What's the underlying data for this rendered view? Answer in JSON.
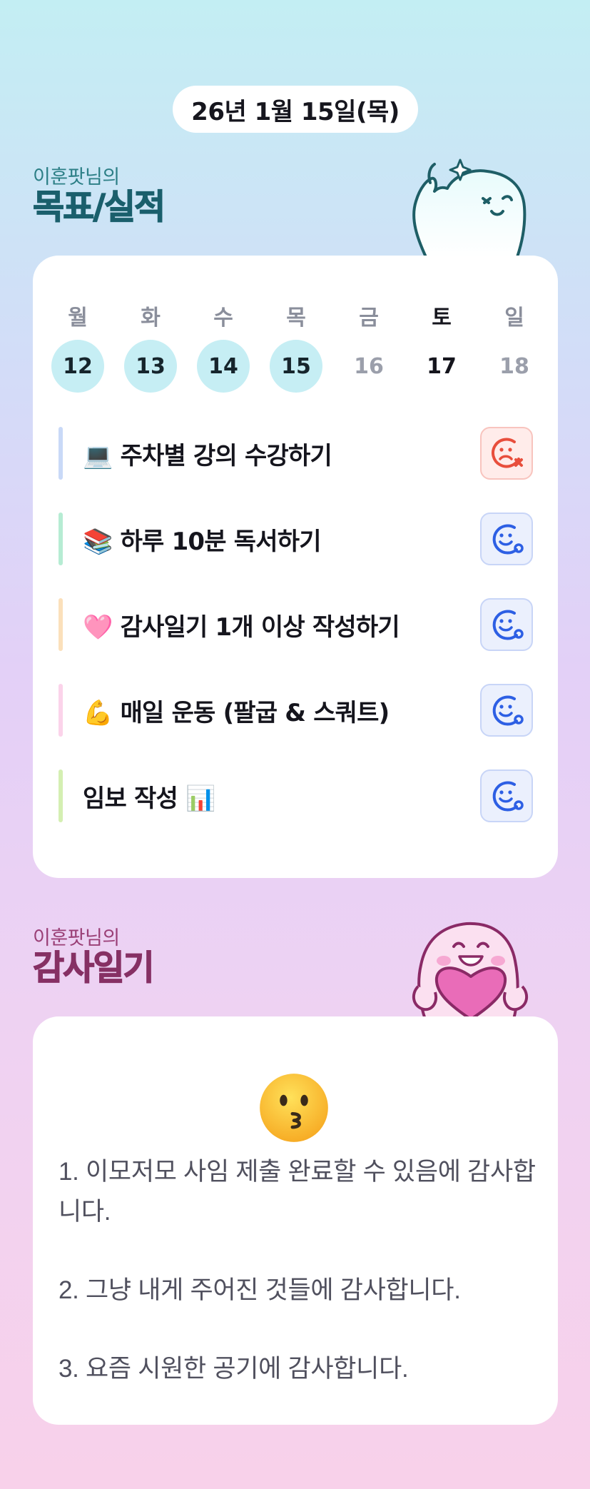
{
  "header": {
    "date": "26년 1월 15일(목)"
  },
  "goals_section": {
    "owner_label": "이훈팟님의",
    "title": "목표/실적",
    "week": {
      "labels": [
        "월",
        "화",
        "수",
        "목",
        "금",
        "토",
        "일"
      ],
      "dates": [
        "12",
        "13",
        "14",
        "15",
        "16",
        "17",
        "18"
      ],
      "completed_days": [
        "12",
        "13",
        "14",
        "15"
      ],
      "today": "17"
    },
    "goals": [
      {
        "text": "💻 주차별 강의 수강하기",
        "status": "failed",
        "status_icon": "sad-face-x-icon",
        "bar_color": "#c9d9f7"
      },
      {
        "text": "📚 하루 10분 독서하기",
        "status": "success",
        "status_icon": "smile-face-check-icon",
        "bar_color": "#b6ecd3"
      },
      {
        "text": "🩷 감사일기 1개 이상 작성하기",
        "status": "success",
        "status_icon": "smile-face-check-icon",
        "bar_color": "#fbe0bb"
      },
      {
        "text": "💪 매일 운동 (팔굽 & 스쿼트)",
        "status": "success",
        "status_icon": "smile-face-check-icon",
        "bar_color": "#fbd3ea"
      },
      {
        "text": "임보 작성 📊",
        "status": "success",
        "status_icon": "smile-face-check-icon",
        "bar_color": "#d4efb2"
      }
    ]
  },
  "gratitude_section": {
    "owner_label": "이훈팟님의",
    "title": "감사일기",
    "emoji": "kissing-face-icon",
    "entries": [
      "1. 이모저모 사임 제출 완료할 수 있음에 감사합니다.",
      "2. 그냥 내게 주어진 것들에 감사합니다.",
      "3. 요즘 시원한 공기에 감사합니다."
    ]
  },
  "colors": {
    "completed_day_bg": "#c6eef4",
    "failed_red": "#e84e3c",
    "success_blue": "#2d5fe4",
    "goals_title": "#1a5f6c",
    "gratitude_title": "#863064"
  }
}
